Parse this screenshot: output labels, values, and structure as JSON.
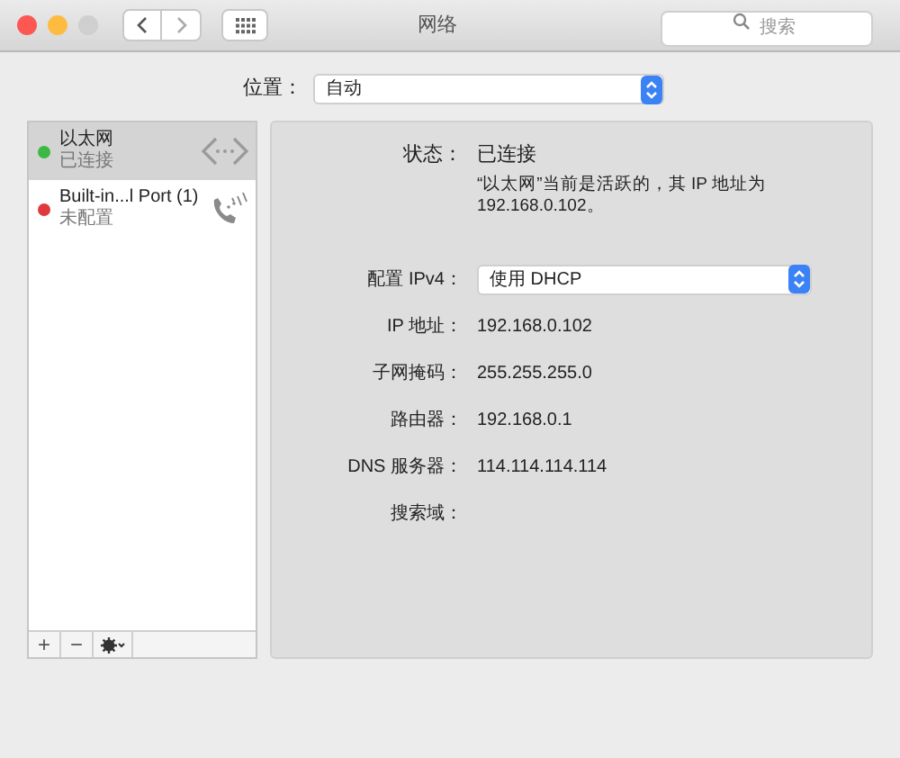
{
  "window": {
    "title": "网络",
    "search": {
      "placeholder": "搜索"
    }
  },
  "location": {
    "label": "位置：",
    "value": "自动"
  },
  "services": [
    {
      "name": "以太网",
      "status": "已连接",
      "color": "#3db845",
      "selected": true,
      "kind": "ethernet"
    },
    {
      "name": "Built-in...l Port (1)",
      "status": "未配置",
      "color": "#e0393e",
      "selected": false,
      "kind": "phone"
    }
  ],
  "service_toolbar": [
    "+",
    "−"
  ],
  "details": {
    "status_label": "状态：",
    "status_value": "已连接",
    "status_note": "“以太网”当前是活跃的，其 IP 地址为 192.168.0.102。",
    "config_label": "配置 IPv4：",
    "config_value": "使用 DHCP",
    "fields": [
      {
        "label": "IP 地址：",
        "value": "192.168.0.102"
      },
      {
        "label": "子网掩码：",
        "value": "255.255.255.0"
      },
      {
        "label": "路由器：",
        "value": "192.168.0.1"
      },
      {
        "label": "DNS 服务器：",
        "value": "114.114.114.114"
      },
      {
        "label": "搜索域："
      }
    ]
  }
}
